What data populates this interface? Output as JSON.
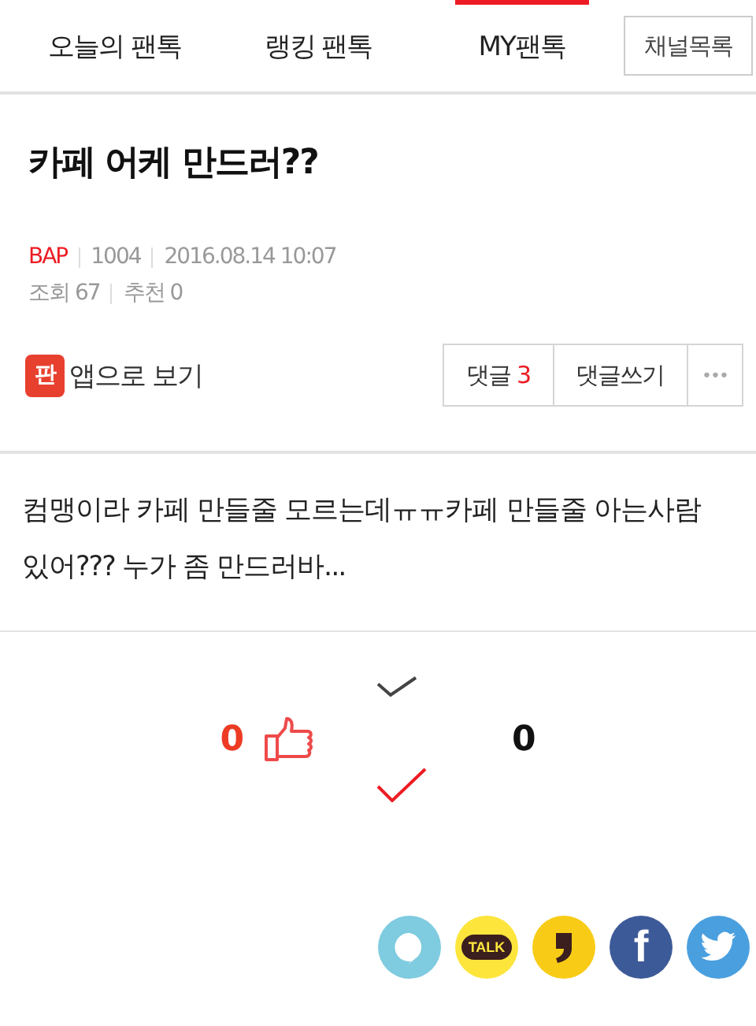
{
  "tabs": [
    {
      "label": "오늘의 팬톡",
      "selected": false
    },
    {
      "label": "랭킹 팬톡",
      "selected": false
    },
    {
      "label": "MY팬톡",
      "selected": true
    }
  ],
  "channel_list_button": "채널목록",
  "post": {
    "title": "카페 어케 만드러??",
    "author": "BAP",
    "author_id": "1004",
    "date": "2016.08.14 10:07",
    "views": "조회 67",
    "recommends": "추천 0",
    "body": "컴맹이라 카페 만들줄 모르는데ㅠㅠ카페 만들줄 아는사람 있어??? 누가 좀 만드러바..."
  },
  "app_view": {
    "icon_label": "판",
    "label": "앱으로 보기"
  },
  "actions": {
    "comments_label": "댓글",
    "comments_count": "3",
    "write_comment": "댓글쓰기",
    "more": "•••"
  },
  "votes": {
    "up_count": "0",
    "down_count": "0"
  },
  "share": [
    {
      "kind": "bubble",
      "color": "#7fcbe0"
    },
    {
      "kind": "talk",
      "color": "#fde53c",
      "text": "TALK"
    },
    {
      "kind": "story",
      "color": "#f8cc16"
    },
    {
      "kind": "facebook",
      "color": "#3d5a98",
      "text": "f"
    },
    {
      "kind": "twitter",
      "color": "#4a9fdf"
    }
  ]
}
